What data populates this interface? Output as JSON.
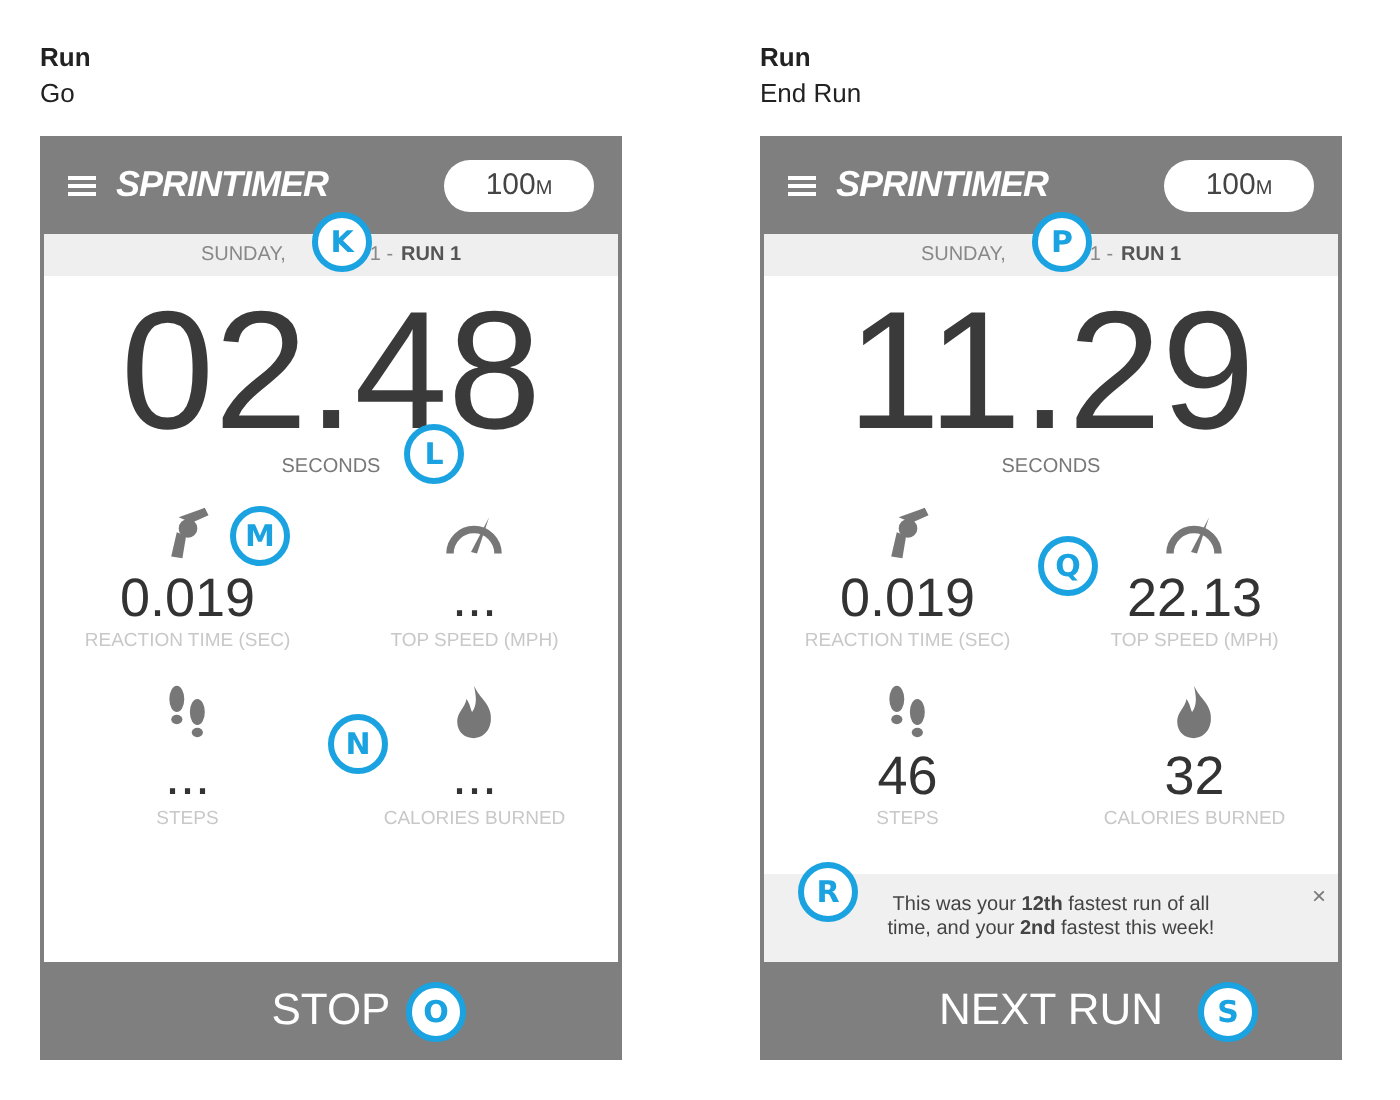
{
  "screens": [
    {
      "title": "Run",
      "subtitle": "Go",
      "logo": "SPRINTIMER",
      "distance": "100",
      "unit": "M",
      "date": {
        "day": "SUNDAY,",
        "tail": "1 -",
        "run": "RUN 1"
      },
      "time": "02.48",
      "time_label": "SECONDS",
      "stats": [
        {
          "kind": "pistol",
          "value": "0.019",
          "label": "REACTION TIME (SEC)"
        },
        {
          "kind": "gauge",
          "value": "...",
          "label": "TOP SPEED (MPH)"
        },
        {
          "kind": "footprints",
          "value": "...",
          "label": "STEPS"
        },
        {
          "kind": "flame",
          "value": "...",
          "label": "CALORIES BURNED"
        }
      ],
      "action": "STOP",
      "callouts": [
        {
          "letter": "K",
          "kind": "date"
        },
        {
          "letter": "L",
          "kind": "seconds"
        },
        {
          "letter": "M",
          "kind": "icon"
        },
        {
          "letter": "N",
          "kind": "lower"
        },
        {
          "letter": "O",
          "kind": "near"
        }
      ]
    },
    {
      "title": "Run",
      "subtitle": "End Run",
      "logo": "SPRINTIMER",
      "distance": "100",
      "unit": "M",
      "date": {
        "day": "SUNDAY,",
        "tail": "1 -",
        "run": "RUN 1"
      },
      "time": "11.29",
      "time_label": "SECONDS",
      "stats": [
        {
          "kind": "pistol",
          "value": "0.019",
          "label": "REACTION TIME (SEC)"
        },
        {
          "kind": "gauge",
          "value": "22.13",
          "label": "TOP SPEED (MPH)"
        },
        {
          "kind": "footprints",
          "value": "46",
          "label": "STEPS"
        },
        {
          "kind": "flame",
          "value": "32",
          "label": "CALORIES BURNED"
        }
      ],
      "banner": {
        "text": "This was your **12th** fastest run of all time, and your **2nd** fastest this week!",
        "close": "×"
      },
      "action": "NEXT RUN",
      "callouts": [
        {
          "letter": "P",
          "kind": "date"
        },
        {
          "letter": "Q",
          "kind": "upper"
        },
        {
          "letter": "R",
          "kind": "banner"
        },
        {
          "letter": "S",
          "kind": "far"
        }
      ]
    }
  ]
}
